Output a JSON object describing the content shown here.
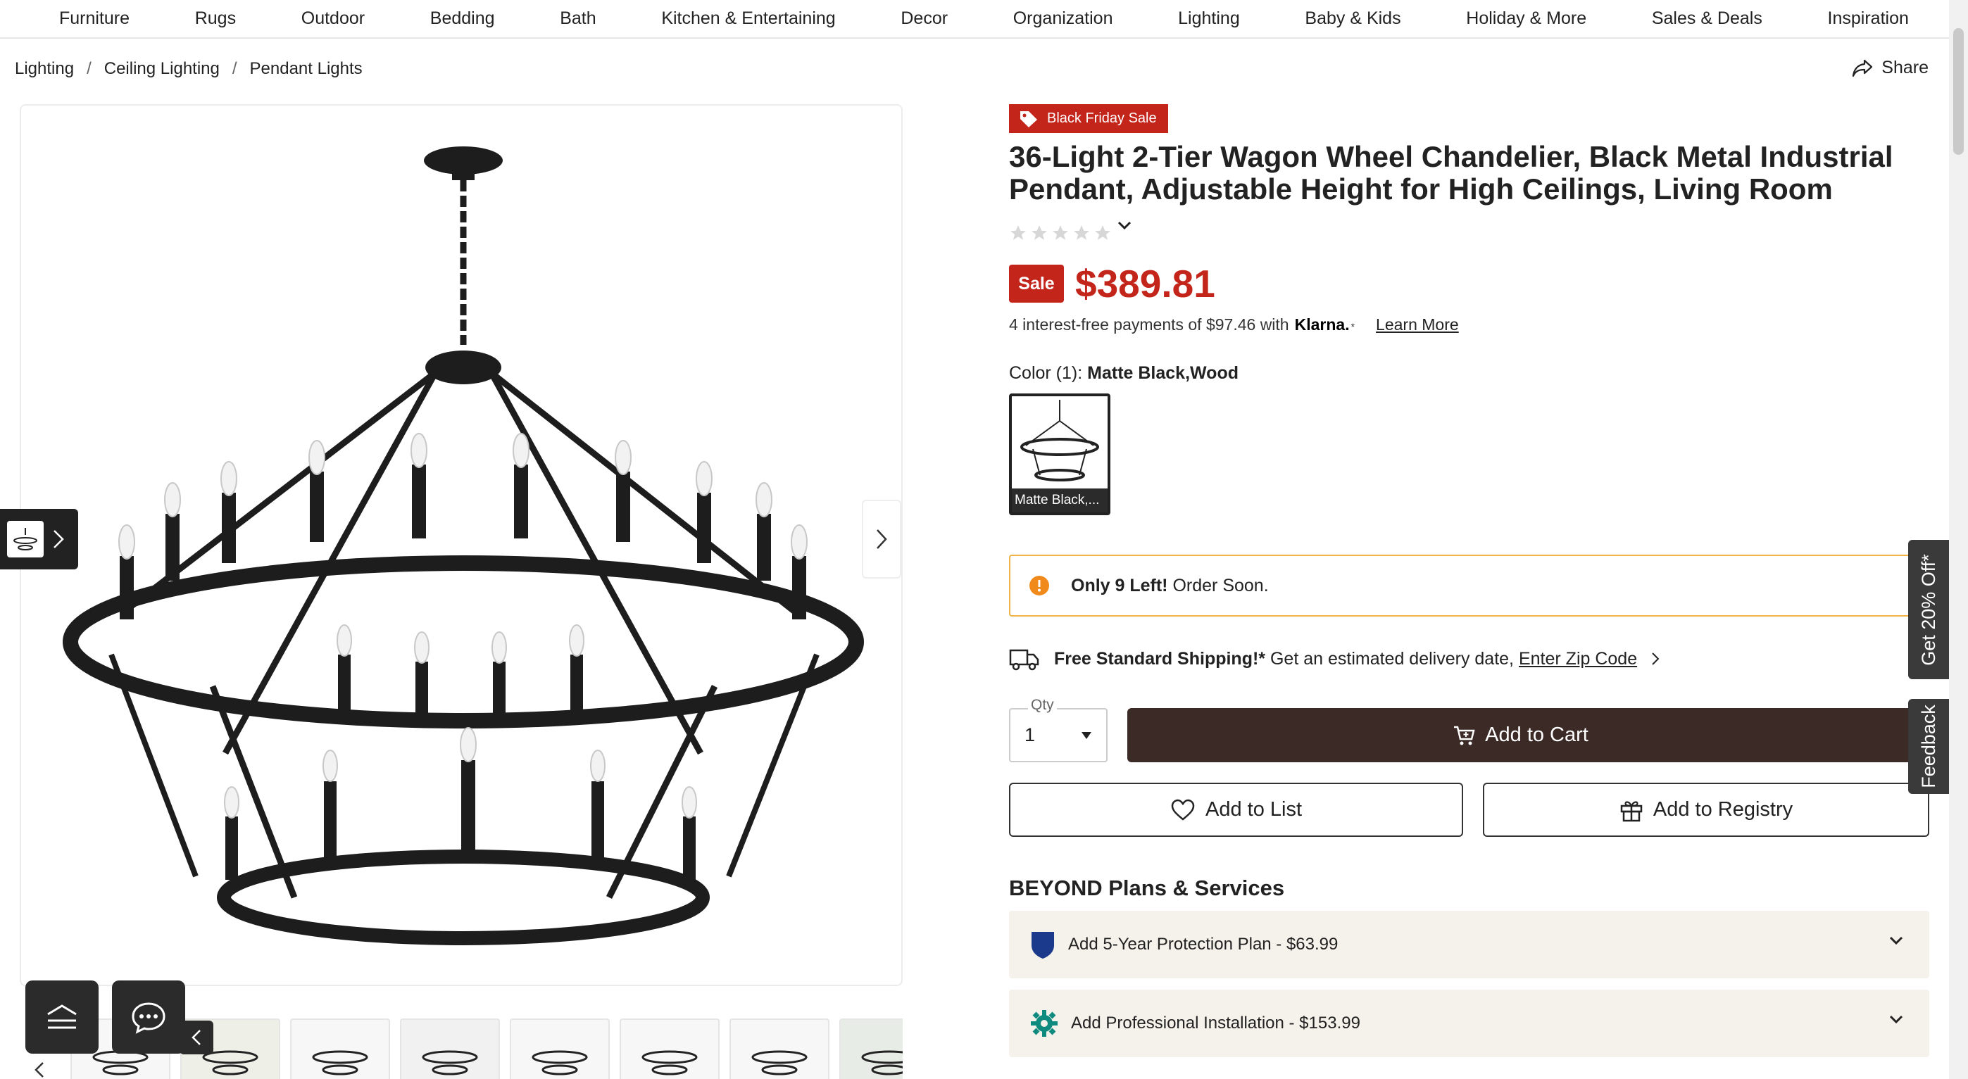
{
  "nav": {
    "items": [
      "Furniture",
      "Rugs",
      "Outdoor",
      "Bedding",
      "Bath",
      "Kitchen & Entertaining",
      "Decor",
      "Organization",
      "Lighting",
      "Baby & Kids",
      "Holiday & More",
      "Sales & Deals",
      "Inspiration"
    ]
  },
  "breadcrumb": {
    "items": [
      "Lighting",
      "Ceiling Lighting",
      "Pendant Lights"
    ],
    "separator": "/"
  },
  "share": {
    "label": "Share"
  },
  "product": {
    "promo_badge": "Black Friday Sale",
    "title": "36-Light 2-Tier Wagon Wheel Chandelier, Black Metal Industrial Pendant, Adjustable Height for High Ceilings, Living Room",
    "rating": 0,
    "sale_badge": "Sale",
    "price": "$389.81",
    "klarna": {
      "text": "4 interest-free payments of $97.46 with",
      "logo": "Klarna.",
      "asterisk": "*",
      "link": "Learn More"
    },
    "color": {
      "label": "Color (1):",
      "value": "Matte Black,Wood",
      "swatch_caption": "Matte Black,..."
    },
    "stock": {
      "bold": "Only 9 Left!",
      "rest": "Order Soon.",
      "accent": "#f08a1c"
    },
    "shipping": {
      "bold": "Free Standard Shipping!*",
      "text": "Get an estimated delivery date,",
      "link": "Enter Zip Code"
    },
    "qty": {
      "label": "Qty",
      "value": "1"
    },
    "add_to_cart": "Add to Cart",
    "add_to_list": "Add to List",
    "add_to_registry": "Add to Registry"
  },
  "plans": {
    "title": "BEYOND Plans & Services",
    "items": [
      {
        "label": "Add 5-Year Protection Plan - $63.99",
        "icon": "shield-icon"
      },
      {
        "label": "Add Professional Installation - $153.99",
        "icon": "gear-icon"
      }
    ]
  },
  "side_tabs": {
    "offer": "Get 20% Off*",
    "feedback": "Feedback"
  },
  "colors": {
    "sale_red": "#c4251b",
    "cart_brown": "#3b2a26",
    "stock_border": "#f0b347",
    "plan_bg": "#f5f2eb"
  }
}
